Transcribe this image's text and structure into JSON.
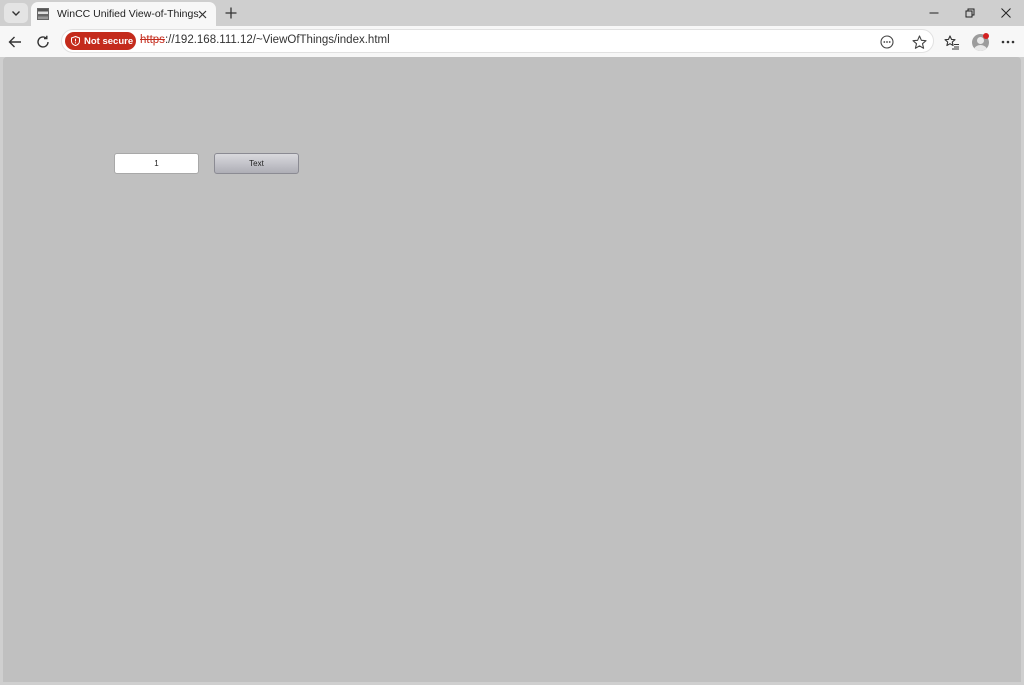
{
  "browser": {
    "tab": {
      "title": "WinCC Unified View-of-Things",
      "favicon": "wincc-favicon"
    },
    "address": {
      "security_label": "Not secure",
      "url_scheme": "https",
      "url_rest": "://192.168.111.12/~ViewOfThings/index.html"
    },
    "icons": {
      "tab_menu": "chevron-down-icon",
      "close_tab": "close-icon",
      "new_tab": "plus-icon",
      "minimize": "minimize-icon",
      "restore": "restore-icon",
      "close_window": "close-icon",
      "back": "back-arrow-icon",
      "refresh": "refresh-icon",
      "reader": "reader-mode-icon",
      "favorite": "star-icon",
      "favorites": "favorites-list-icon",
      "profile": "avatar",
      "menu": "more-icon"
    },
    "colors": {
      "security_chip": "#c42b1c",
      "page_background": "#c0c0c0"
    }
  },
  "hmi": {
    "io_field_value": "1",
    "button_label": "Text"
  }
}
